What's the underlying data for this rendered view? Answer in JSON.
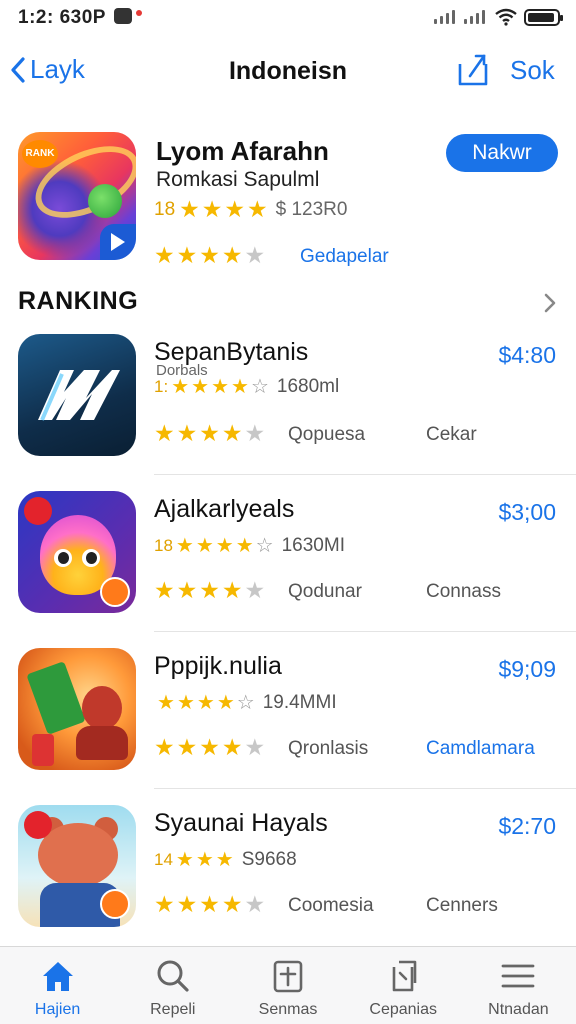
{
  "status_bar": {
    "time": "1:2: 630P"
  },
  "nav": {
    "back_label": "Layk",
    "title": "Indoneisn",
    "right_label": "Sok"
  },
  "featured": {
    "name": "Lyom Afarahn",
    "subtitle": "Romkasi Sapulml",
    "rating_num": "18",
    "size": "$ 123R0",
    "category": "Gedapelar",
    "get_label": "Nakwr",
    "icon_tag": "RANK",
    "rating_stars": 4
  },
  "section": {
    "title": "RANKING"
  },
  "rankings": [
    {
      "name": "SepanBytanis",
      "subname": "Dorbals",
      "rating_num": "1:",
      "size": "1680ml",
      "cat1": "Qopuesa",
      "cat2": "Cekar",
      "cat2_blue": false,
      "price": "$4:80"
    },
    {
      "name": "Ajalkarlyeals",
      "subname": "",
      "rating_num": "18",
      "size": "1630MI",
      "cat1": "Qodunar",
      "cat2": "Connass",
      "cat2_blue": false,
      "price": "$3;00"
    },
    {
      "name": "Pppijk.nulia",
      "subname": "",
      "rating_num": "",
      "size": "19.4MMI",
      "cat1": "Qronlasis",
      "cat2": "Camdlamara",
      "cat2_blue": true,
      "price": "$9;09"
    },
    {
      "name": "Syaunai Hayals",
      "subname": "",
      "rating_num": "14",
      "size": "S9668",
      "cat1": "Coomesia",
      "cat2": "Cenners",
      "cat2_blue": false,
      "price": "$2:70"
    }
  ],
  "tabs": [
    {
      "label": "Hajien",
      "icon": "home-icon",
      "active": true
    },
    {
      "label": "Repeli",
      "icon": "search-icon",
      "active": false
    },
    {
      "label": "Senmas",
      "icon": "add-box-icon",
      "active": false
    },
    {
      "label": "Cepanias",
      "icon": "copy-icon",
      "active": false
    },
    {
      "label": "Ntnadan",
      "icon": "menu-icon",
      "active": false
    }
  ]
}
